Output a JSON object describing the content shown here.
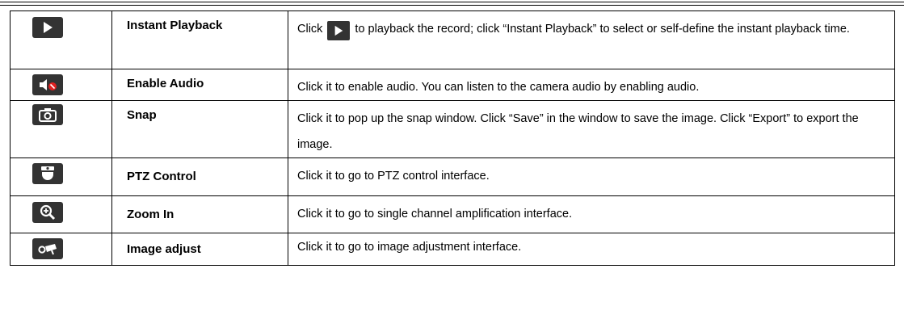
{
  "rows": [
    {
      "icon": "play-icon",
      "name": "Instant Playback",
      "desc_before": "Click",
      "desc_after": "to playback the record; click “Instant Playback” to select or self-define the instant playback time."
    },
    {
      "icon": "audio-disabled-icon",
      "name": "Enable Audio",
      "desc": "Click it to enable audio. You can listen to the camera audio by enabling audio."
    },
    {
      "icon": "camera-snap-icon",
      "name": "Snap",
      "desc": "Click it to pop up the snap window. Click “Save” in the window to save the image. Click “Export” to export the image."
    },
    {
      "icon": "ptz-dome-icon",
      "name": "PTZ Control",
      "desc": "Click it to go to PTZ control interface."
    },
    {
      "icon": "zoom-in-icon",
      "name": "Zoom In",
      "desc": "Click it to go to single channel amplification interface."
    },
    {
      "icon": "image-adjust-icon",
      "name": "Image adjust",
      "desc": "Click it to go to image adjustment interface."
    }
  ],
  "colors": {
    "icon_bg": "#333333",
    "icon_fg": "#ffffff",
    "mute_red": "#e02020"
  }
}
